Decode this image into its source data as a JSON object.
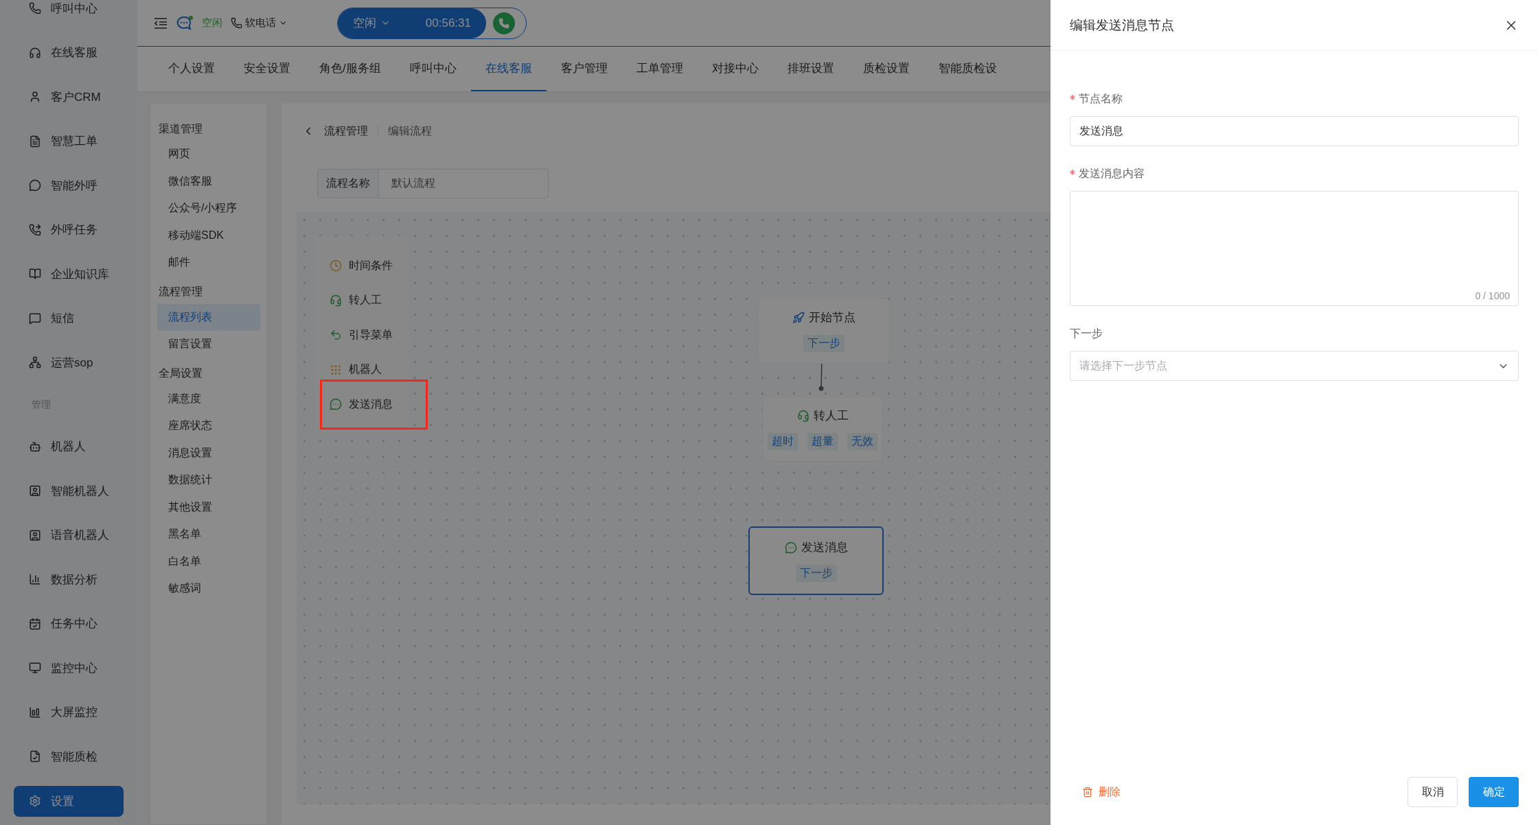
{
  "nav": {
    "items": [
      {
        "kind": "item",
        "label": "呼叫中心",
        "selected": false
      },
      {
        "kind": "item",
        "label": "在线客服",
        "selected": false
      },
      {
        "kind": "item",
        "label": "客户CRM",
        "selected": false
      },
      {
        "kind": "item",
        "label": "智慧工单",
        "selected": false
      },
      {
        "kind": "item",
        "label": "智能外呼",
        "selected": false
      },
      {
        "kind": "item",
        "label": "外呼任务",
        "selected": false
      },
      {
        "kind": "item",
        "label": "企业知识库",
        "selected": false
      },
      {
        "kind": "item",
        "label": "短信",
        "selected": false
      },
      {
        "kind": "item",
        "label": "运营sop",
        "selected": false
      },
      {
        "kind": "section",
        "label": "管理"
      },
      {
        "kind": "item",
        "label": "机器人",
        "selected": false
      },
      {
        "kind": "item",
        "label": "智能机器人",
        "selected": false
      },
      {
        "kind": "item",
        "label": "语音机器人",
        "selected": false
      },
      {
        "kind": "item",
        "label": "数据分析",
        "selected": false
      },
      {
        "kind": "item",
        "label": "任务中心",
        "selected": false
      },
      {
        "kind": "item",
        "label": "监控中心",
        "selected": false
      },
      {
        "kind": "item",
        "label": "大屏监控",
        "selected": false
      },
      {
        "kind": "item",
        "label": "智能质检",
        "selected": false
      },
      {
        "kind": "item",
        "label": "设置",
        "selected": true
      }
    ]
  },
  "top_bar": {
    "status": "空闲",
    "phone_mode": "软电话",
    "call_pill": {
      "status": "空闲",
      "timer": "00:56:31"
    }
  },
  "tabs": [
    {
      "label": "个人设置",
      "selected": false
    },
    {
      "label": "安全设置",
      "selected": false
    },
    {
      "label": "角色/服务组",
      "selected": false
    },
    {
      "label": "呼叫中心",
      "selected": false
    },
    {
      "label": "在线客服",
      "selected": true
    },
    {
      "label": "客户管理",
      "selected": false
    },
    {
      "label": "工单管理",
      "selected": false
    },
    {
      "label": "对接中心",
      "selected": false
    },
    {
      "label": "排班设置",
      "selected": false
    },
    {
      "label": "质检设置",
      "selected": false
    },
    {
      "label": "智能质检设",
      "selected": false
    }
  ],
  "settings_menu": [
    {
      "title": "渠道管理",
      "items": [
        {
          "label": "网页",
          "selected": false
        },
        {
          "label": "微信客服",
          "selected": false
        },
        {
          "label": "公众号/小程序",
          "selected": false
        },
        {
          "label": "移动端SDK",
          "selected": false
        },
        {
          "label": "邮件",
          "selected": false
        }
      ]
    },
    {
      "title": "流程管理",
      "items": [
        {
          "label": "流程列表",
          "selected": true
        },
        {
          "label": "留言设置",
          "selected": false
        }
      ]
    },
    {
      "title": "全局设置",
      "items": [
        {
          "label": "满意度",
          "selected": false
        },
        {
          "label": "座席状态",
          "selected": false
        },
        {
          "label": "消息设置",
          "selected": false
        },
        {
          "label": "数据统计",
          "selected": false
        },
        {
          "label": "其他设置",
          "selected": false
        },
        {
          "label": "黑名单",
          "selected": false
        },
        {
          "label": "白名单",
          "selected": false
        },
        {
          "label": "敏感词",
          "selected": false
        }
      ]
    }
  ],
  "breadcrumb": [
    "流程管理",
    "编辑流程"
  ],
  "flow_name": {
    "label": "流程名称",
    "value": "默认流程"
  },
  "palette": [
    {
      "kind": "time",
      "label": "时间条件",
      "highlighted": false
    },
    {
      "kind": "transfer",
      "label": "转人工",
      "highlighted": false
    },
    {
      "kind": "menu",
      "label": "引导菜单",
      "highlighted": false
    },
    {
      "kind": "robot",
      "label": "机器人",
      "highlighted": false
    },
    {
      "kind": "message",
      "label": "发送消息",
      "highlighted": true
    }
  ],
  "nodes": [
    {
      "kind": "start",
      "title": "开始节点",
      "selected": false,
      "ports": [
        "下一步"
      ]
    },
    {
      "kind": "transfer",
      "title": "转人工",
      "selected": false,
      "ports": [
        "超时",
        "超量",
        "无效"
      ]
    },
    {
      "kind": "message",
      "title": "发送消息",
      "selected": true,
      "ports": [
        "下一步"
      ]
    }
  ],
  "drawer": {
    "title": "编辑发送消息节点",
    "fields": [
      {
        "kind": "input",
        "label": "节点名称",
        "required": true,
        "value": "发送消息"
      },
      {
        "kind": "textarea",
        "label": "发送消息内容",
        "required": true,
        "counter": "0 / 1000"
      },
      {
        "kind": "select",
        "label": "下一步",
        "required": false,
        "placeholder": "请选择下一步节点"
      }
    ],
    "delete_label": "删除",
    "buttons": [
      {
        "kind": "default",
        "label": "取消"
      },
      {
        "kind": "primary",
        "label": "确定"
      }
    ]
  }
}
